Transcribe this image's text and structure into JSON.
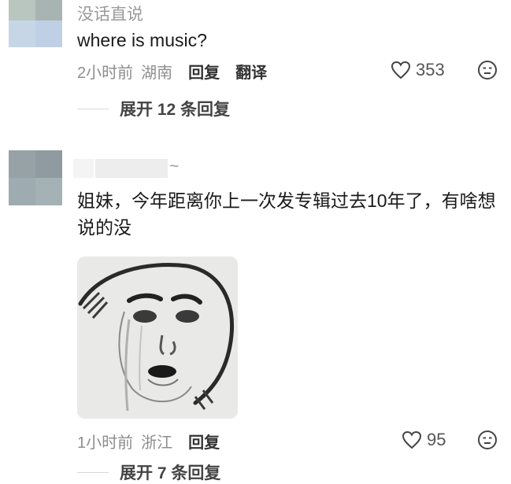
{
  "comments": [
    {
      "username": "没话直说",
      "text": "where is music?",
      "time": "2小时前",
      "location": "湖南",
      "reply_label": "回复",
      "translate_label": "翻译",
      "likes": "353",
      "expand_label": "展开 12 条回复"
    },
    {
      "username_suffix": "~",
      "text": "姐妹，今年距离你上一次发专辑过去10年了，有啥想说的没",
      "time": "1小时前",
      "location": "浙江",
      "reply_label": "回复",
      "likes": "95",
      "expand_label": "展开 7 条回复"
    }
  ],
  "icons": {
    "like": "heart-outline-icon",
    "dislike": "speechless-face-icon"
  },
  "colors": {
    "meta": "#8e8e8e",
    "text": "#1a1a1a",
    "divider": "#d8d8d8"
  }
}
